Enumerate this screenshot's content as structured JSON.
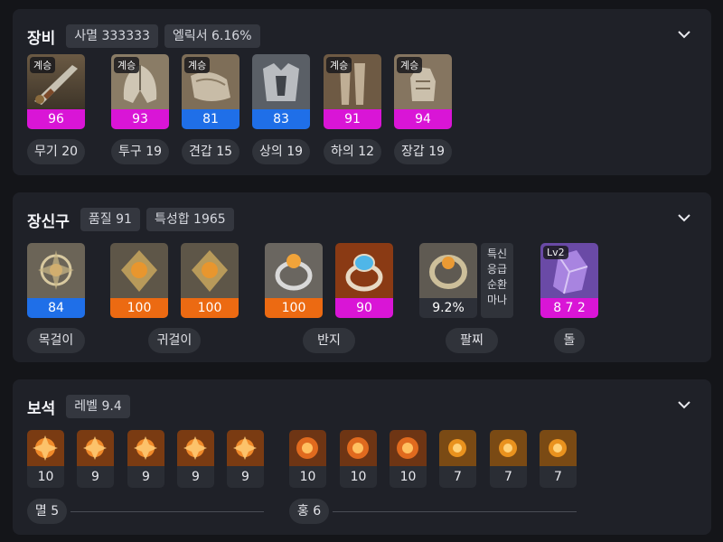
{
  "equipment": {
    "title": "장비",
    "chips": [
      "사멸 333333",
      "엘릭서 6.16%"
    ],
    "items": [
      {
        "badge": "계승",
        "quality": "96",
        "label": "무기 20",
        "bar_color": "#d915d6"
      },
      {
        "badge": "계승",
        "quality": "93",
        "label": "투구 19",
        "bar_color": "#d915d6"
      },
      {
        "badge": "계승",
        "quality": "81",
        "label": "견갑 15",
        "bar_color": "#1f6fe8"
      },
      {
        "badge": "",
        "quality": "83",
        "label": "상의 19",
        "bar_color": "#1f6fe8"
      },
      {
        "badge": "계승",
        "quality": "91",
        "label": "하의 12",
        "bar_color": "#d915d6"
      },
      {
        "badge": "계승",
        "quality": "94",
        "label": "장갑 19",
        "bar_color": "#d915d6"
      }
    ]
  },
  "accessories": {
    "title": "장신구",
    "chips": [
      "품질 91",
      "특성합 1965"
    ],
    "items": [
      {
        "quality": "84",
        "bar_color": "#1f6fe8"
      },
      {
        "quality": "100",
        "bar_color": "#ec6a12"
      },
      {
        "quality": "100",
        "bar_color": "#ec6a12"
      },
      {
        "quality": "100",
        "bar_color": "#ec6a12"
      },
      {
        "quality": "90",
        "bar_color": "#d915d6"
      },
      {
        "quality": "9.2%",
        "bar_color": "#2d3038"
      },
      {
        "badge": "Lv2",
        "quality": "8 7 2",
        "bar_color": "#d915d6"
      }
    ],
    "labels": [
      "목걸이",
      "귀걸이",
      "반지",
      "팔찌",
      "돌"
    ],
    "bracelet_stats": [
      "특신",
      "응급",
      "순환",
      "마나"
    ]
  },
  "gems": {
    "title": "보석",
    "chips": [
      "레벨 9.4"
    ],
    "left_levels": [
      "10",
      "9",
      "9",
      "9",
      "9"
    ],
    "right_levels": [
      "10",
      "10",
      "10",
      "7",
      "7",
      "7"
    ],
    "left_label": "멸 5",
    "right_label": "홍 6"
  }
}
